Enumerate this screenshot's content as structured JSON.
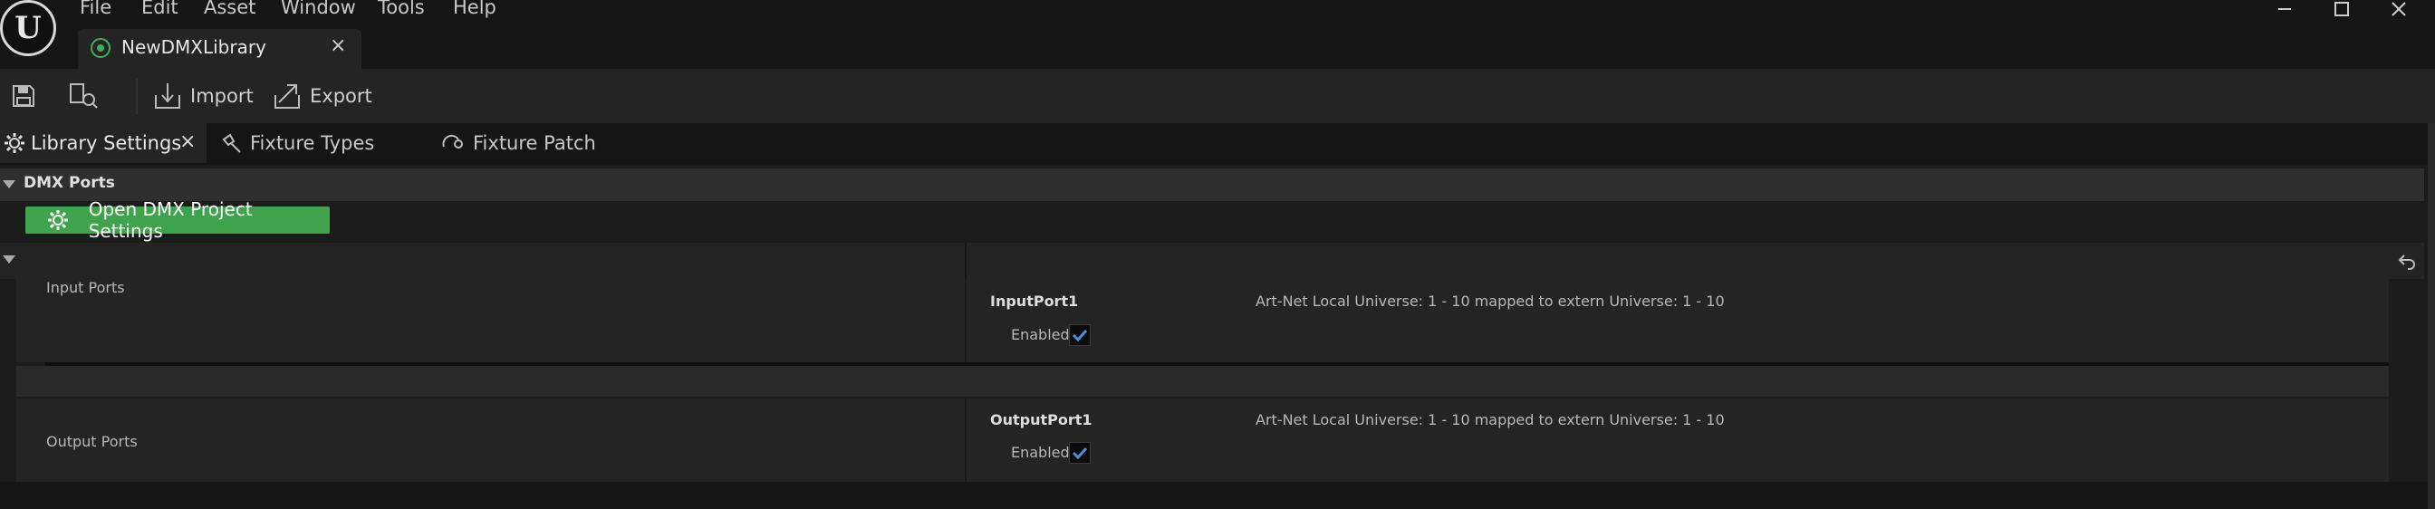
{
  "app": {
    "logo_text": "U"
  },
  "menu": [
    "File",
    "Edit",
    "Asset",
    "Window",
    "Tools",
    "Help"
  ],
  "window_controls": {
    "minimize": "—",
    "maximize": "☐",
    "close": "✕"
  },
  "document_tab": {
    "label": "NewDMXLibrary",
    "close": "×",
    "icon": "dmx-library-icon"
  },
  "toolbar": {
    "save_icon": "save-icon",
    "browse_icon": "browse-icon",
    "import_label": "Import",
    "export_label": "Export"
  },
  "panel_tabs": [
    {
      "label": "Library Settings",
      "icon": "gear-icon",
      "active": true,
      "close": "×"
    },
    {
      "label": "Fixture Types",
      "icon": "fixture-icon",
      "active": false
    },
    {
      "label": "Fixture Patch",
      "icon": "patch-icon",
      "active": false
    }
  ],
  "details": {
    "category": "DMX Ports",
    "open_settings_label": "Open DMX Project Settings",
    "reset_icon": "reset-arrow-icon",
    "input_ports": {
      "label": "Input Ports",
      "port_name": "InputPort1",
      "summary": "Art-Net Local Universe: 1 - 10 mapped to extern Universe: 1 - 10",
      "enabled_label": "Enabled",
      "enabled": true
    },
    "output_ports": {
      "label": "Output Ports",
      "port_name": "OutputPort1",
      "summary": "Art-Net Local Universe: 1 - 10 mapped to extern Universe: 1 - 10",
      "enabled_label": "Enabled",
      "enabled": true
    }
  },
  "colors": {
    "accent_green": "#3fa34d",
    "check_blue": "#4a8ee0"
  }
}
